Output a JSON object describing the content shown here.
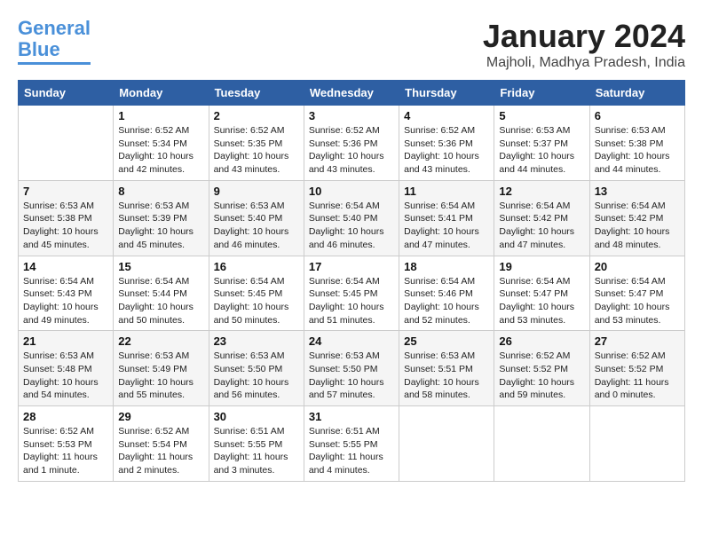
{
  "logo": {
    "line1": "General",
    "line2": "Blue"
  },
  "title": "January 2024",
  "subtitle": "Majholi, Madhya Pradesh, India",
  "days_header": [
    "Sunday",
    "Monday",
    "Tuesday",
    "Wednesday",
    "Thursday",
    "Friday",
    "Saturday"
  ],
  "weeks": [
    [
      {
        "day": "",
        "info": ""
      },
      {
        "day": "1",
        "info": "Sunrise: 6:52 AM\nSunset: 5:34 PM\nDaylight: 10 hours\nand 42 minutes."
      },
      {
        "day": "2",
        "info": "Sunrise: 6:52 AM\nSunset: 5:35 PM\nDaylight: 10 hours\nand 43 minutes."
      },
      {
        "day": "3",
        "info": "Sunrise: 6:52 AM\nSunset: 5:36 PM\nDaylight: 10 hours\nand 43 minutes."
      },
      {
        "day": "4",
        "info": "Sunrise: 6:52 AM\nSunset: 5:36 PM\nDaylight: 10 hours\nand 43 minutes."
      },
      {
        "day": "5",
        "info": "Sunrise: 6:53 AM\nSunset: 5:37 PM\nDaylight: 10 hours\nand 44 minutes."
      },
      {
        "day": "6",
        "info": "Sunrise: 6:53 AM\nSunset: 5:38 PM\nDaylight: 10 hours\nand 44 minutes."
      }
    ],
    [
      {
        "day": "7",
        "info": "Sunrise: 6:53 AM\nSunset: 5:38 PM\nDaylight: 10 hours\nand 45 minutes."
      },
      {
        "day": "8",
        "info": "Sunrise: 6:53 AM\nSunset: 5:39 PM\nDaylight: 10 hours\nand 45 minutes."
      },
      {
        "day": "9",
        "info": "Sunrise: 6:53 AM\nSunset: 5:40 PM\nDaylight: 10 hours\nand 46 minutes."
      },
      {
        "day": "10",
        "info": "Sunrise: 6:54 AM\nSunset: 5:40 PM\nDaylight: 10 hours\nand 46 minutes."
      },
      {
        "day": "11",
        "info": "Sunrise: 6:54 AM\nSunset: 5:41 PM\nDaylight: 10 hours\nand 47 minutes."
      },
      {
        "day": "12",
        "info": "Sunrise: 6:54 AM\nSunset: 5:42 PM\nDaylight: 10 hours\nand 47 minutes."
      },
      {
        "day": "13",
        "info": "Sunrise: 6:54 AM\nSunset: 5:42 PM\nDaylight: 10 hours\nand 48 minutes."
      }
    ],
    [
      {
        "day": "14",
        "info": "Sunrise: 6:54 AM\nSunset: 5:43 PM\nDaylight: 10 hours\nand 49 minutes."
      },
      {
        "day": "15",
        "info": "Sunrise: 6:54 AM\nSunset: 5:44 PM\nDaylight: 10 hours\nand 50 minutes."
      },
      {
        "day": "16",
        "info": "Sunrise: 6:54 AM\nSunset: 5:45 PM\nDaylight: 10 hours\nand 50 minutes."
      },
      {
        "day": "17",
        "info": "Sunrise: 6:54 AM\nSunset: 5:45 PM\nDaylight: 10 hours\nand 51 minutes."
      },
      {
        "day": "18",
        "info": "Sunrise: 6:54 AM\nSunset: 5:46 PM\nDaylight: 10 hours\nand 52 minutes."
      },
      {
        "day": "19",
        "info": "Sunrise: 6:54 AM\nSunset: 5:47 PM\nDaylight: 10 hours\nand 53 minutes."
      },
      {
        "day": "20",
        "info": "Sunrise: 6:54 AM\nSunset: 5:47 PM\nDaylight: 10 hours\nand 53 minutes."
      }
    ],
    [
      {
        "day": "21",
        "info": "Sunrise: 6:53 AM\nSunset: 5:48 PM\nDaylight: 10 hours\nand 54 minutes."
      },
      {
        "day": "22",
        "info": "Sunrise: 6:53 AM\nSunset: 5:49 PM\nDaylight: 10 hours\nand 55 minutes."
      },
      {
        "day": "23",
        "info": "Sunrise: 6:53 AM\nSunset: 5:50 PM\nDaylight: 10 hours\nand 56 minutes."
      },
      {
        "day": "24",
        "info": "Sunrise: 6:53 AM\nSunset: 5:50 PM\nDaylight: 10 hours\nand 57 minutes."
      },
      {
        "day": "25",
        "info": "Sunrise: 6:53 AM\nSunset: 5:51 PM\nDaylight: 10 hours\nand 58 minutes."
      },
      {
        "day": "26",
        "info": "Sunrise: 6:52 AM\nSunset: 5:52 PM\nDaylight: 10 hours\nand 59 minutes."
      },
      {
        "day": "27",
        "info": "Sunrise: 6:52 AM\nSunset: 5:52 PM\nDaylight: 11 hours\nand 0 minutes."
      }
    ],
    [
      {
        "day": "28",
        "info": "Sunrise: 6:52 AM\nSunset: 5:53 PM\nDaylight: 11 hours\nand 1 minute."
      },
      {
        "day": "29",
        "info": "Sunrise: 6:52 AM\nSunset: 5:54 PM\nDaylight: 11 hours\nand 2 minutes."
      },
      {
        "day": "30",
        "info": "Sunrise: 6:51 AM\nSunset: 5:55 PM\nDaylight: 11 hours\nand 3 minutes."
      },
      {
        "day": "31",
        "info": "Sunrise: 6:51 AM\nSunset: 5:55 PM\nDaylight: 11 hours\nand 4 minutes."
      },
      {
        "day": "",
        "info": ""
      },
      {
        "day": "",
        "info": ""
      },
      {
        "day": "",
        "info": ""
      }
    ]
  ]
}
